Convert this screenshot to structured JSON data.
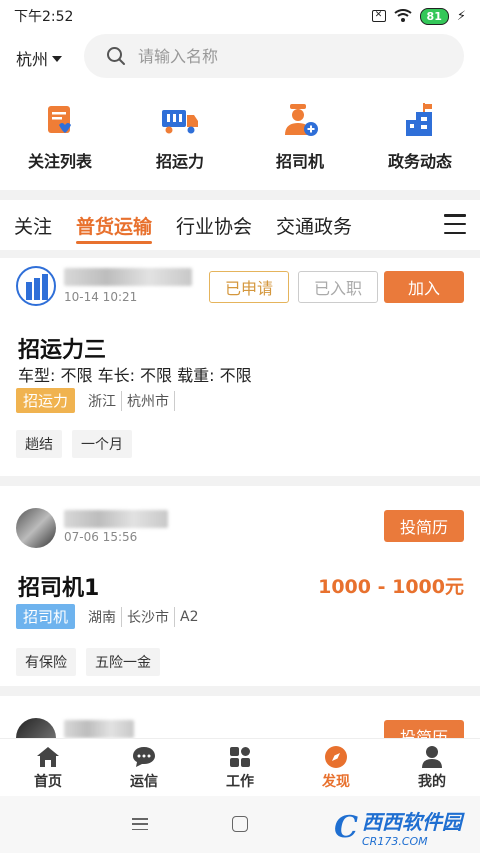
{
  "status_bar": {
    "time": "下午2:52",
    "battery": "81"
  },
  "header": {
    "city": "杭州",
    "search_placeholder": "请输入名称"
  },
  "quick_actions": [
    {
      "label": "关注列表",
      "icon": "bookmark-list-icon"
    },
    {
      "label": "招运力",
      "icon": "truck-icon"
    },
    {
      "label": "招司机",
      "icon": "driver-add-icon"
    },
    {
      "label": "政务动态",
      "icon": "government-building-icon"
    }
  ],
  "tabs": [
    {
      "label": "关注",
      "active": false
    },
    {
      "label": "普货运输",
      "active": true
    },
    {
      "label": "行业协会",
      "active": false
    },
    {
      "label": "交通政务",
      "active": false
    }
  ],
  "cards": [
    {
      "date": "10-14 10:21",
      "buttons": {
        "applied": "已申请",
        "joined": "已入职",
        "join": "加入"
      },
      "title": "招运力三",
      "specs": "车型: 不限  车长: 不限  载重: 不限",
      "tag": "招运力",
      "locations": [
        "浙江",
        "杭州市"
      ],
      "chips": [
        "趟结",
        "一个月"
      ]
    },
    {
      "date": "07-06 15:56",
      "buttons": {
        "resume": "投简历"
      },
      "title": "招司机1",
      "salary": "1000 - 1000元",
      "tag": "招司机",
      "locations": [
        "湖南",
        "长沙市",
        "A2"
      ],
      "chips": [
        "有保险",
        "五险一金"
      ]
    },
    {
      "buttons": {
        "resume": "投简历"
      }
    }
  ],
  "bottom_nav": [
    {
      "label": "首页",
      "icon": "home-icon",
      "active": false
    },
    {
      "label": "运信",
      "icon": "chat-bubble-icon",
      "active": false
    },
    {
      "label": "工作",
      "icon": "grid-apps-icon",
      "active": false
    },
    {
      "label": "发现",
      "icon": "compass-icon",
      "active": true
    },
    {
      "label": "我的",
      "icon": "user-profile-icon",
      "active": false
    }
  ],
  "watermark": {
    "logo": "C",
    "text": "西西软件园",
    "sub": "CR173.COM"
  },
  "colors": {
    "accent": "#e8712e",
    "tag_orange": "#f0b350",
    "tag_blue": "#6eb3ee",
    "icon_blue": "#2f6fd8"
  }
}
